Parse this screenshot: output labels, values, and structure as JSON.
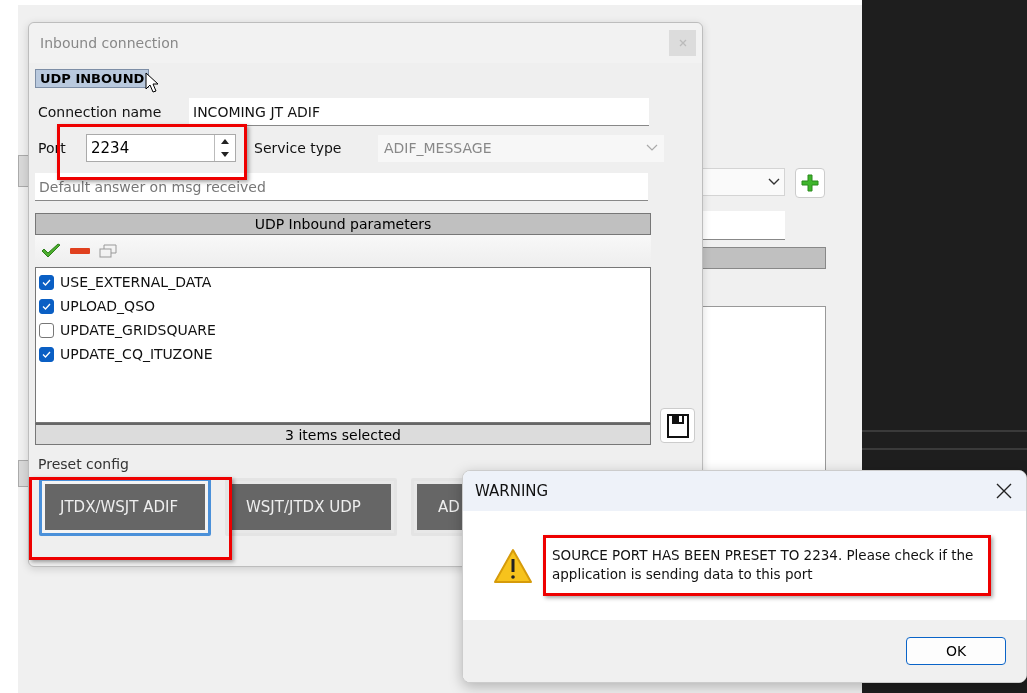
{
  "dialog": {
    "title": "Inbound connection",
    "section_label": "UDP INBOUND",
    "connection_name_label": "Connection name",
    "connection_name": "INCOMING JT ADIF",
    "port_label": "Port",
    "port": "2234",
    "service_type_label": "Service type",
    "service_type": "ADIF_MESSAGE",
    "default_answer_placeholder": "Default answer on msg received",
    "parameters_header": "UDP Inbound parameters",
    "parameters": [
      {
        "label": "USE_EXTERNAL_DATA",
        "checked": true
      },
      {
        "label": "UPLOAD_QSO",
        "checked": true
      },
      {
        "label": "UPDATE_GRIDSQUARE",
        "checked": false
      },
      {
        "label": "UPDATE_CQ_ITUZONE",
        "checked": true
      }
    ],
    "status": "3 items selected",
    "preset_label": "Preset config",
    "presets": [
      {
        "label": "JTDX/WSJT ADIF",
        "selected": true
      },
      {
        "label": "WSJT/JTDX UDP",
        "selected": false
      },
      {
        "label": "AD",
        "selected": false
      }
    ]
  },
  "warning": {
    "title": "WARNING",
    "message": "SOURCE PORT HAS BEEN PRESET TO 2234. Please check if the application is sending data to this port",
    "ok": "OK"
  }
}
